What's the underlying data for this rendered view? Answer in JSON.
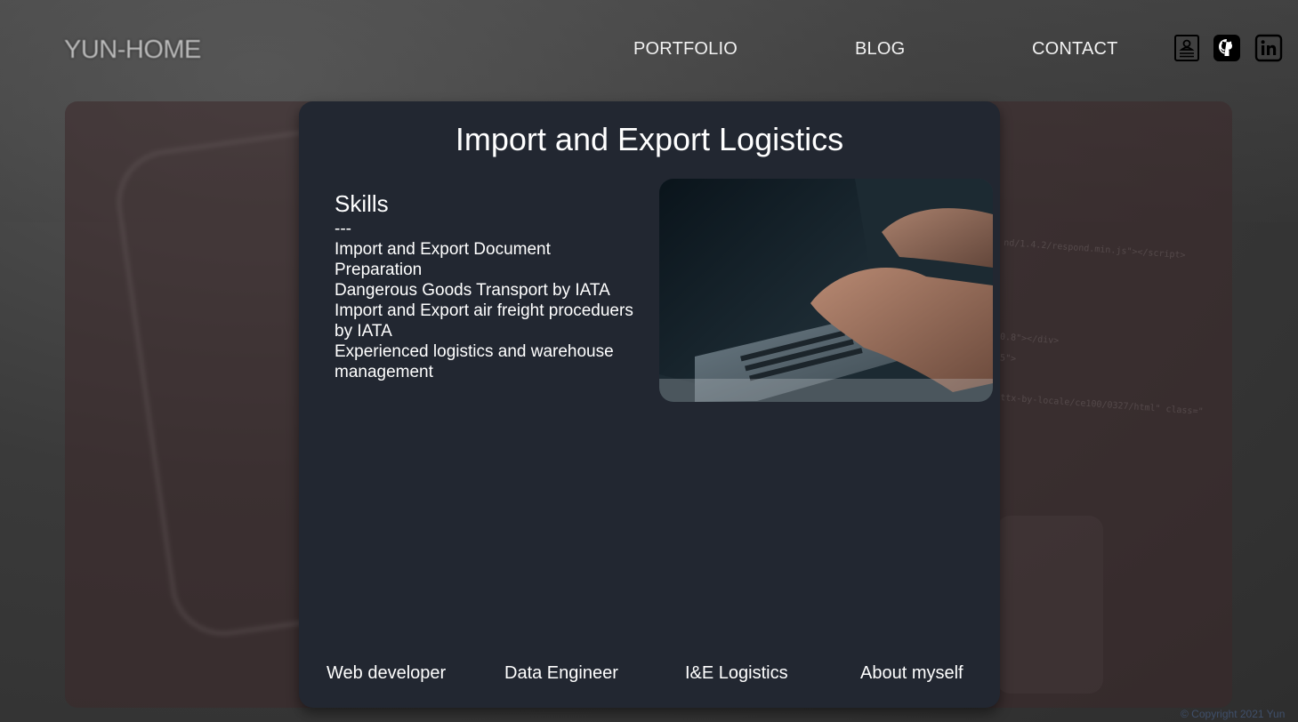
{
  "header": {
    "logo": "YUN-HOME",
    "nav": [
      {
        "label": "PORTFOLIO"
      },
      {
        "label": "BLOG"
      },
      {
        "label": "CONTACT"
      }
    ],
    "icons": [
      "resume-icon",
      "github-icon",
      "linkedin-icon"
    ]
  },
  "card": {
    "title": "Import and Export Logistics",
    "skills_heading": "Skills",
    "skills_separator": "---",
    "skills": [
      "Import and Export Document Preparation",
      "Dangerous Goods Transport by IATA",
      "Import and Export air freight proceduers by IATA",
      "Experienced logistics and warehouse management"
    ],
    "photo_icon": "laptop-typing-photo"
  },
  "footer_nav": [
    {
      "label": "Web developer"
    },
    {
      "label": "Data Engineer"
    },
    {
      "label": "I&E Logistics"
    },
    {
      "label": "About myself"
    }
  ],
  "copyright": "© Copyright 2021 Yun",
  "colors": {
    "card_background": "#222731",
    "nav_text": "#f2f2f2",
    "page_background": "#3e3e3e"
  }
}
